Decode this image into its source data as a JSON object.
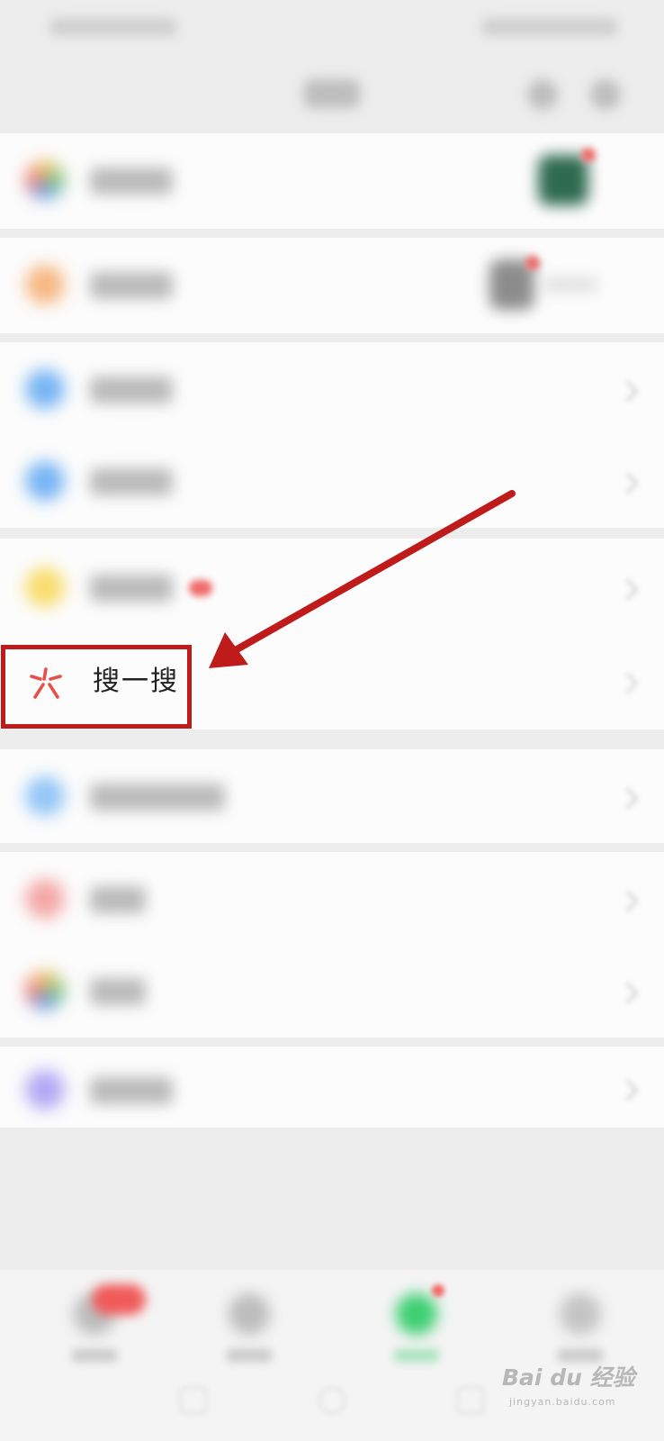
{
  "search_row": {
    "label": "搜一搜"
  },
  "watermark": {
    "main": "Bai du 经验",
    "sub": "jingyan.baidu.com"
  },
  "colors": {
    "annotation_red": "#bf1b1b",
    "search_icon_red": "#e8504a",
    "page_bg": "#ededed"
  },
  "icons": {
    "search_row": "search-spark-icon",
    "annotation": "red-arrow"
  }
}
